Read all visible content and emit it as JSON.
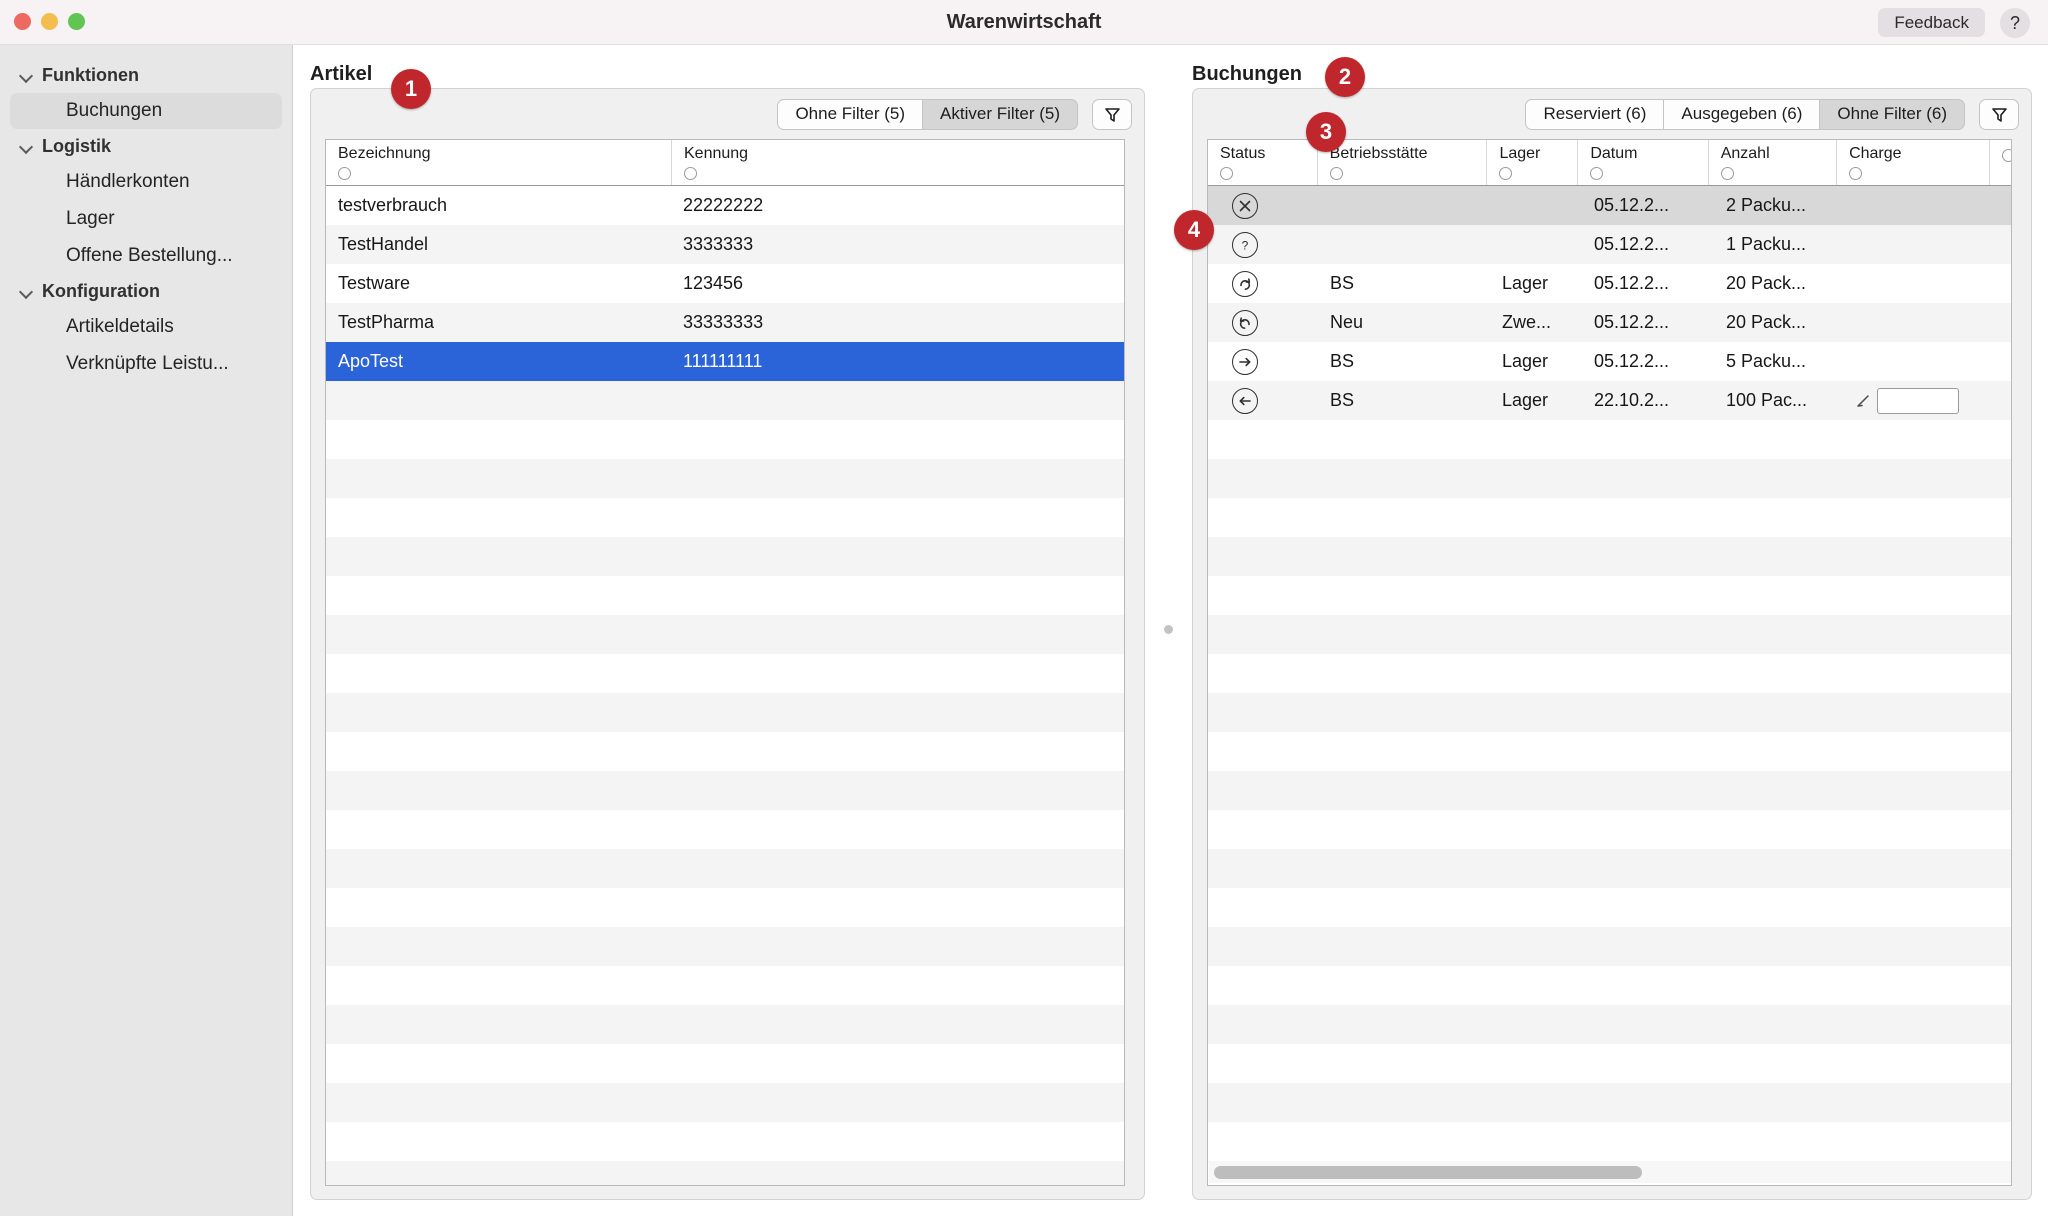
{
  "window": {
    "title": "Warenwirtschaft",
    "feedback_label": "Feedback",
    "help_label": "?"
  },
  "sidebar": {
    "groups": [
      {
        "label": "Funktionen",
        "items": [
          {
            "label": "Buchungen",
            "selected": true
          }
        ]
      },
      {
        "label": "Logistik",
        "items": [
          {
            "label": "Händlerkonten",
            "selected": false
          },
          {
            "label": "Lager",
            "selected": false
          },
          {
            "label": "Offene Bestellung...",
            "selected": false
          }
        ]
      },
      {
        "label": "Konfiguration",
        "items": [
          {
            "label": "Artikeldetails",
            "selected": false
          },
          {
            "label": "Verknüpfte Leistu...",
            "selected": false
          }
        ]
      }
    ]
  },
  "artikel": {
    "title": "Artikel",
    "badge": "1",
    "filters": [
      {
        "label": "Ohne Filter (5)",
        "active": false
      },
      {
        "label": "Aktiver Filter (5)",
        "active": true
      }
    ],
    "filter_icon": "funnel-icon",
    "columns": [
      "Bezeichnung",
      "Kennung"
    ],
    "rows": [
      {
        "Bezeichnung": "testverbrauch",
        "Kennung": "22222222",
        "selected": false
      },
      {
        "Bezeichnung": "TestHandel",
        "Kennung": "3333333",
        "selected": false
      },
      {
        "Bezeichnung": "Testware",
        "Kennung": "123456",
        "selected": false
      },
      {
        "Bezeichnung": "TestPharma",
        "Kennung": "33333333",
        "selected": false
      },
      {
        "Bezeichnung": "ApoTest",
        "Kennung": "111111111",
        "selected": true
      }
    ]
  },
  "buchungen": {
    "title": "Buchungen",
    "badge": "2",
    "filter_badge": "3",
    "row_badge": "4",
    "filters": [
      {
        "label": "Reserviert (6)",
        "active": false
      },
      {
        "label": "Ausgegeben (6)",
        "active": false
      },
      {
        "label": "Ohne Filter (6)",
        "active": true
      }
    ],
    "filter_icon": "funnel-icon",
    "columns": [
      "Status",
      "Betriebsstätte",
      "Lager",
      "Datum",
      "Anzahl",
      "Charge"
    ],
    "rows": [
      {
        "status_icon": "circle-x-icon",
        "Betriebsstätte": "",
        "Lager": "",
        "Datum": "05.12.2...",
        "Anzahl": "2 Packu...",
        "Charge": "",
        "selected": true
      },
      {
        "status_icon": "circle-question-icon",
        "Betriebsstätte": "",
        "Lager": "",
        "Datum": "05.12.2...",
        "Anzahl": "1 Packu...",
        "Charge": "",
        "selected": false
      },
      {
        "status_icon": "circle-redo-icon",
        "Betriebsstätte": "BS",
        "Lager": "Lager",
        "Datum": "05.12.2...",
        "Anzahl": "20 Pack...",
        "Charge": "",
        "selected": false
      },
      {
        "status_icon": "circle-undo-icon",
        "Betriebsstätte": "Neu",
        "Lager": "Zwe...",
        "Datum": "05.12.2...",
        "Anzahl": "20 Pack...",
        "Charge": "",
        "selected": false
      },
      {
        "status_icon": "circle-arrow-right-icon",
        "Betriebsstätte": "BS",
        "Lager": "Lager",
        "Datum": "05.12.2...",
        "Anzahl": "5 Packu...",
        "Charge": "",
        "selected": false
      },
      {
        "status_icon": "circle-arrow-left-icon",
        "Betriebsstätte": "BS",
        "Lager": "Lager",
        "Datum": "22.10.2...",
        "Anzahl": "100 Pac...",
        "Charge": "",
        "charge_editable": true,
        "charge_value": "",
        "selected": false
      }
    ]
  },
  "colors": {
    "badge_red": "#c0272d",
    "selection_blue": "#2b63d9",
    "titlebar": "#f7f2f4",
    "sidebar": "#e7e7e7"
  }
}
